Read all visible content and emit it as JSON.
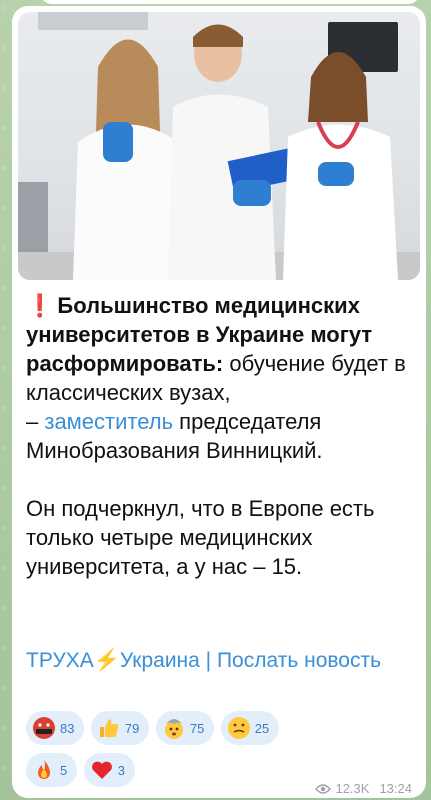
{
  "post": {
    "title_bold": "Большинство медицинских университетов в Украине могут расформировать:",
    "text_1": "обучение будет в классических вузах,",
    "text_dash": "– ",
    "text_link": "заместитель",
    "text_2": "председателя Минобразования Винницкий.",
    "paragraph_2": "Он подчеркнул, что в Европе есть только четыре медицинских университета, а у нас – 15.",
    "signature_channel": "ТРУХА⚡Украина",
    "signature_sep": " | ",
    "signature_action": "Послать новость"
  },
  "reactions": [
    {
      "icon": "angry-face-icon",
      "count": "83"
    },
    {
      "icon": "thumbs-up-icon",
      "count": "79"
    },
    {
      "icon": "exploding-head-icon",
      "count": "75"
    },
    {
      "icon": "grimacing-face-icon",
      "count": "25"
    },
    {
      "icon": "fire-icon",
      "count": "5"
    },
    {
      "icon": "heart-icon",
      "count": "3"
    }
  ],
  "meta": {
    "views": "12.3K",
    "time": "13:24"
  },
  "colors": {
    "link": "#3a8fd8",
    "reaction_bg": "#e2eefa",
    "exclamation": "#e0302a"
  }
}
